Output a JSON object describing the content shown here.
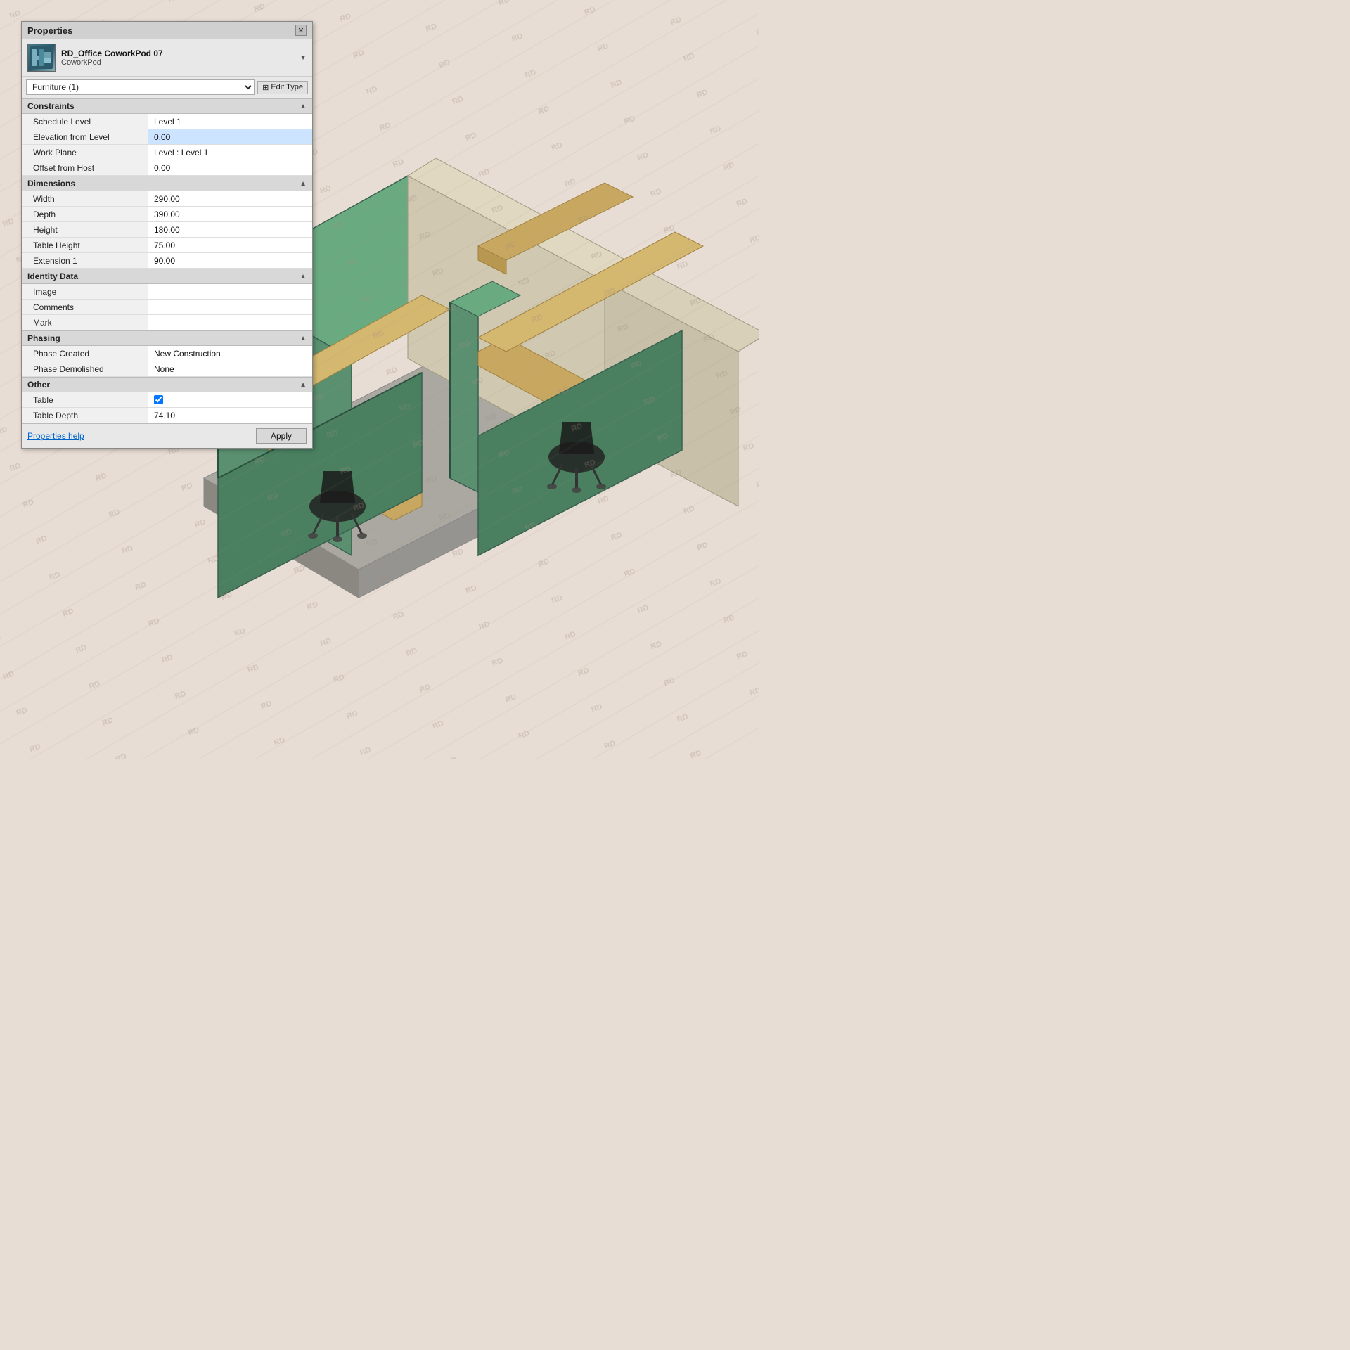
{
  "panel": {
    "title": "Properties",
    "close_label": "✕",
    "element_name": "RD_Office CoworkPod 07",
    "element_type": "CoworkPod",
    "type_dropdown_value": "Furniture (1)",
    "edit_type_label": "Edit Type",
    "sections": [
      {
        "name": "Constraints",
        "properties": [
          {
            "label": "Schedule Level",
            "value": "Level 1",
            "editable": false,
            "highlighted": false
          },
          {
            "label": "Elevation from Level",
            "value": "0.00",
            "editable": true,
            "highlighted": true
          },
          {
            "label": "Work Plane",
            "value": "Level : Level 1",
            "editable": false,
            "highlighted": false
          },
          {
            "label": "Offset from Host",
            "value": "0.00",
            "editable": false,
            "highlighted": false
          }
        ]
      },
      {
        "name": "Dimensions",
        "properties": [
          {
            "label": "Width",
            "value": "290.00",
            "editable": false,
            "highlighted": false
          },
          {
            "label": "Depth",
            "value": "390.00",
            "editable": false,
            "highlighted": false
          },
          {
            "label": "Height",
            "value": "180.00",
            "editable": false,
            "highlighted": false
          },
          {
            "label": "Table Height",
            "value": "75.00",
            "editable": false,
            "highlighted": false
          },
          {
            "label": "Extension 1",
            "value": "90.00",
            "editable": false,
            "highlighted": false
          }
        ]
      },
      {
        "name": "Identity Data",
        "properties": [
          {
            "label": "Image",
            "value": "",
            "editable": false,
            "highlighted": false
          },
          {
            "label": "Comments",
            "value": "",
            "editable": false,
            "highlighted": false
          },
          {
            "label": "Mark",
            "value": "",
            "editable": false,
            "highlighted": false
          }
        ]
      },
      {
        "name": "Phasing",
        "properties": [
          {
            "label": "Phase Created",
            "value": "New Construction",
            "editable": false,
            "highlighted": false
          },
          {
            "label": "Phase Demolished",
            "value": "None",
            "editable": false,
            "highlighted": false
          }
        ]
      },
      {
        "name": "Other",
        "properties": [
          {
            "label": "Table",
            "value": "checkbox_checked",
            "editable": false,
            "highlighted": false
          },
          {
            "label": "Table Depth",
            "value": "74.10",
            "editable": false,
            "highlighted": false
          }
        ]
      }
    ],
    "footer": {
      "help_label": "Properties help",
      "apply_label": "Apply"
    }
  },
  "watermark_text": "RD"
}
